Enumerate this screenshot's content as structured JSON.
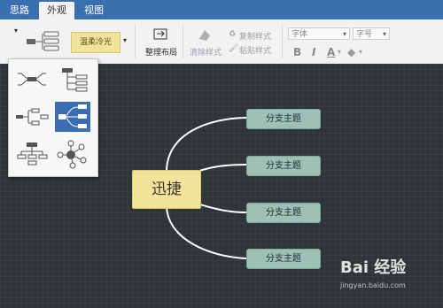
{
  "tabs": [
    "思路",
    "外观",
    "视图"
  ],
  "active_tab": "外观",
  "ribbon": {
    "theme_name": "温柔冷光",
    "layout_label": "整理布局",
    "clear_style": "清除样式",
    "copy_style": "复制样式",
    "paste_style": "粘贴样式",
    "font_placeholder": "字体",
    "font_size_placeholder": "字号",
    "bold": "B",
    "italic": "I",
    "font_color": "A",
    "fill": "◆"
  },
  "mindmap": {
    "root": "迅捷",
    "branches": [
      "分支主题",
      "分支主题",
      "分支主题",
      "分支主题"
    ]
  },
  "watermark": {
    "logo": "Bai 经验",
    "url": "jingyan.baidu.com"
  },
  "colors": {
    "canvas": "#2f3436",
    "root_fill": "#f2e39a",
    "branch_fill": "#9dbfb5",
    "connector": "#ffffff",
    "selected_layout": "#3b6db4"
  }
}
